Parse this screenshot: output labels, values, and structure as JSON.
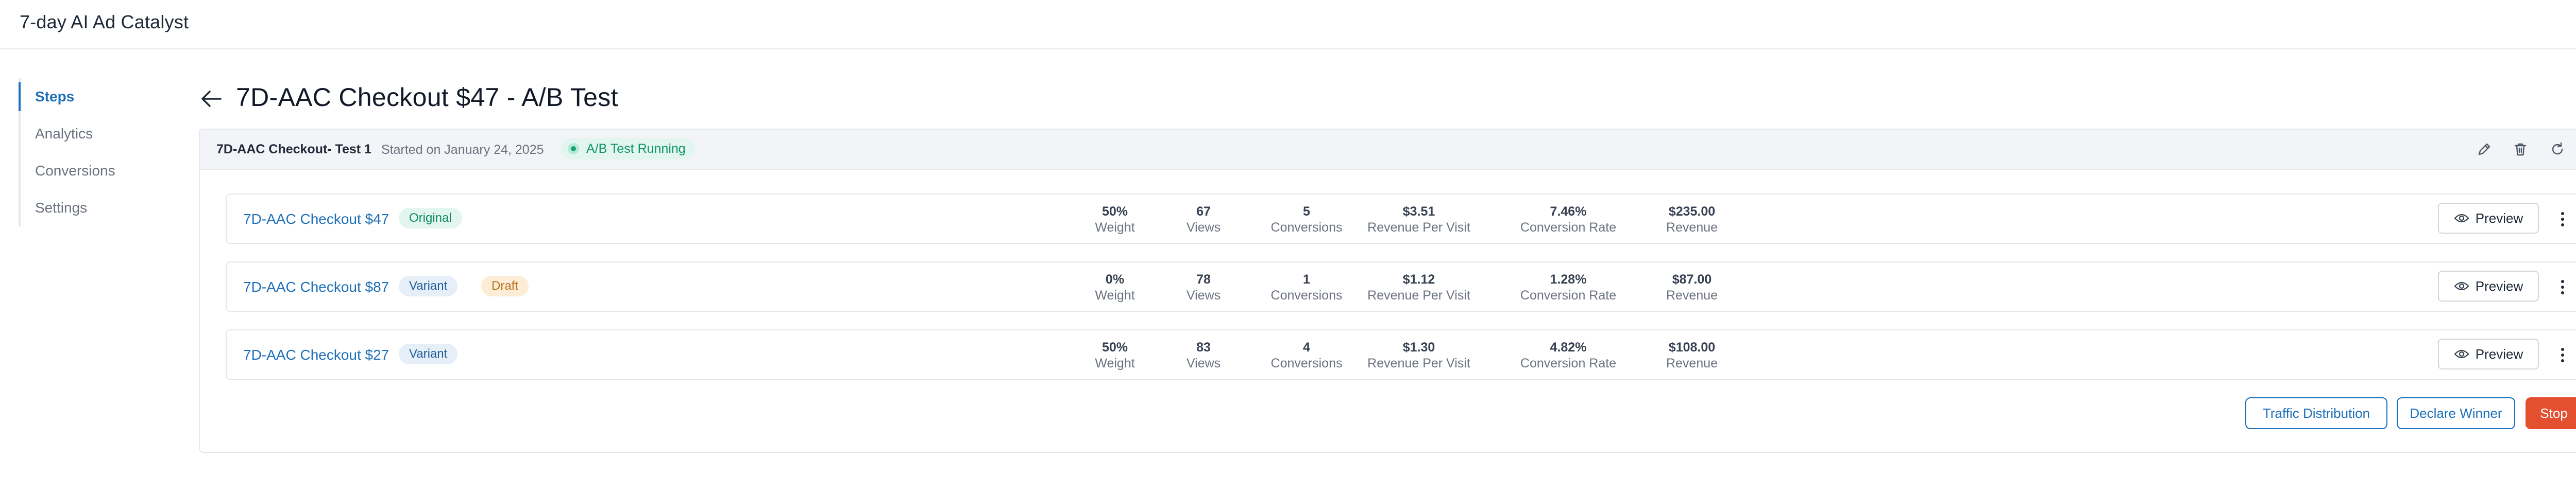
{
  "app": {
    "title": "7-day AI Ad Catalyst"
  },
  "sidebar": {
    "items": [
      {
        "label": "Steps",
        "active": true
      },
      {
        "label": "Analytics",
        "active": false
      },
      {
        "label": "Conversions",
        "active": false
      },
      {
        "label": "Settings",
        "active": false
      }
    ]
  },
  "page": {
    "title": "7D-AAC Checkout $47 - A/B Test"
  },
  "test": {
    "name": "7D-AAC Checkout- Test 1",
    "started": "Started on January 24, 2025",
    "status": "A/B Test Running"
  },
  "metric_labels": {
    "weight": "Weight",
    "views": "Views",
    "conversions": "Conversions",
    "rpv": "Revenue Per Visit",
    "conv_rate": "Conversion Rate",
    "revenue": "Revenue"
  },
  "rows": [
    {
      "name": "7D-AAC Checkout $47",
      "badges": [
        "Original"
      ],
      "weight": "50%",
      "views": "67",
      "conversions": "5",
      "rpv": "$3.51",
      "conv_rate": "7.46%",
      "revenue": "$235.00",
      "preview_label": "Preview"
    },
    {
      "name": "7D-AAC Checkout $87",
      "badges": [
        "Variant",
        "Draft"
      ],
      "weight": "0%",
      "views": "78",
      "conversions": "1",
      "rpv": "$1.12",
      "conv_rate": "1.28%",
      "revenue": "$87.00",
      "preview_label": "Preview"
    },
    {
      "name": "7D-AAC Checkout $27",
      "badges": [
        "Variant"
      ],
      "weight": "50%",
      "views": "83",
      "conversions": "4",
      "rpv": "$1.30",
      "conv_rate": "4.82%",
      "revenue": "$108.00",
      "preview_label": "Preview"
    }
  ],
  "actions": {
    "traffic_distribution": "Traffic Distribution",
    "declare_winner": "Declare Winner",
    "stop": "Stop"
  },
  "icons": {
    "close": "close-icon",
    "back": "arrow-left-icon",
    "edit": "pencil-icon",
    "delete": "trash-icon",
    "refresh": "refresh-icon",
    "collapse": "chevron-up-icon",
    "preview": "eye-icon",
    "more": "kebab-icon"
  },
  "colors": {
    "accent": "#1d6fb8",
    "success": "#16a37a",
    "stop": "#e4502f",
    "draft": "#b8731e"
  }
}
